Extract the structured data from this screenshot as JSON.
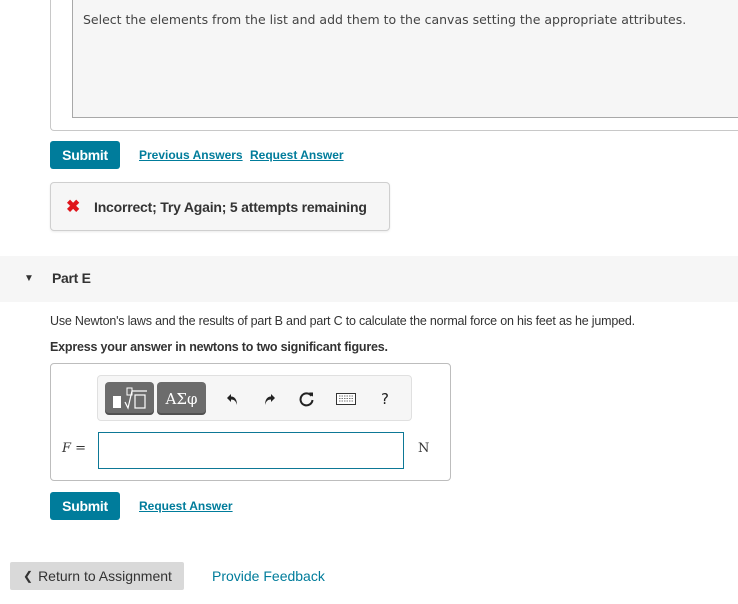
{
  "part_d": {
    "canvas_instruction": "Select the elements from the list and add them to the canvas setting the appropriate attributes.",
    "submit_label": "Submit",
    "previous_answers_label": "Previous Answers",
    "request_answer_label": "Request Answer",
    "feedback": {
      "icon": "x-mark-icon",
      "icon_color": "#e0151b",
      "text": "Incorrect; Try Again; 5 attempts remaining"
    }
  },
  "part_e": {
    "caret": "▼",
    "title": "Part E",
    "question": "Use Newton's laws and the results of part B and part C to calculate the normal force on his feet as he jumped.",
    "instruction": "Express your answer in newtons to two significant figures.",
    "toolbar": {
      "templates_icon": "templates-radical-icon",
      "symbols_label": "ΑΣφ",
      "undo_icon": "undo-icon",
      "redo_icon": "redo-icon",
      "reset_icon": "reset-icon",
      "keyboard_icon": "keyboard-icon",
      "help_label": "?"
    },
    "variable": "F",
    "equals": "=",
    "answer_value": "",
    "unit": "N",
    "submit_label": "Submit",
    "request_answer_label": "Request Answer"
  },
  "footer": {
    "return_chevron": "❮",
    "return_label": "Return to Assignment",
    "provide_feedback_label": "Provide Feedback"
  },
  "colors": {
    "accent": "#007c9b",
    "input_border": "#0d7896",
    "panel_bg": "#f6f6f6"
  }
}
